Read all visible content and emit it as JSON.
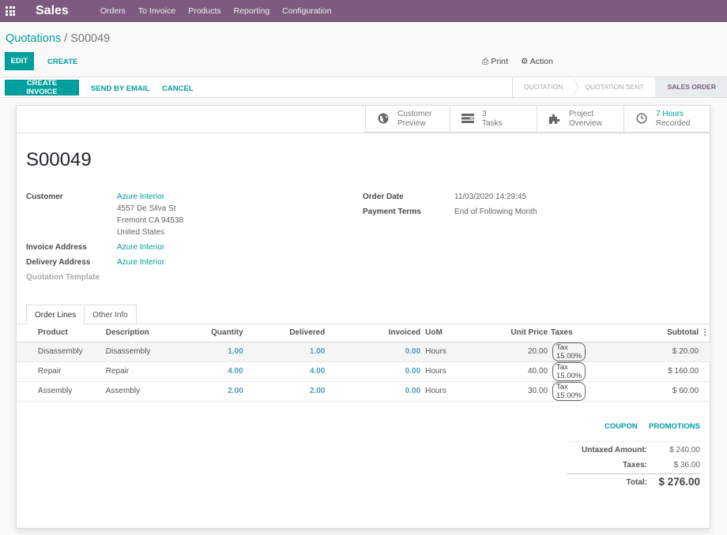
{
  "navbar": {
    "app_name": "Sales",
    "menu": [
      "Orders",
      "To Invoice",
      "Products",
      "Reporting",
      "Configuration"
    ],
    "bg_color": "#7c5b7e"
  },
  "breadcrumb": {
    "parent": "Quotations",
    "separator": " / ",
    "current": "S00049"
  },
  "control": {
    "edit": "EDIT",
    "create": "CREATE",
    "print": "Print",
    "action": "Action"
  },
  "statusbar": {
    "buttons": {
      "create_invoice": "CREATE INVOICE",
      "send_by_email": "SEND BY EMAIL",
      "cancel": "CANCEL"
    },
    "stages": [
      {
        "label": "QUOTATION",
        "active": false
      },
      {
        "label": "QUOTATION SENT",
        "active": false
      },
      {
        "label": "SALES ORDER",
        "active": true
      }
    ]
  },
  "smart_buttons": [
    {
      "icon": "globe-icon",
      "value": "Customer",
      "label": "Preview"
    },
    {
      "icon": "tasks-icon",
      "value": "3",
      "label": "Tasks"
    },
    {
      "icon": "puzzle-icon",
      "value": "Project",
      "label": "Overview"
    },
    {
      "icon": "clock-icon",
      "value": "7 Hours",
      "label": "Recorded"
    }
  ],
  "order": {
    "name": "S00049",
    "customer_label": "Customer",
    "customer_name": "Azure Interior",
    "customer_address": [
      "4557 De Silva St",
      "Fremont CA 94538",
      "United States"
    ],
    "invoice_address_label": "Invoice Address",
    "invoice_address": "Azure Interior",
    "delivery_address_label": "Delivery Address",
    "delivery_address": "Azure Interior",
    "quotation_template_label": "Quotation Template",
    "order_date_label": "Order Date",
    "order_date": "11/03/2020 14:29:45",
    "payment_terms_label": "Payment Terms",
    "payment_terms": "End of Following Month"
  },
  "tabs": [
    "Order Lines",
    "Other Info"
  ],
  "lines": {
    "columns": [
      "Product",
      "Description",
      "Quantity",
      "Delivered",
      "Invoiced",
      "UoM",
      "Unit Price",
      "Taxes",
      "Subtotal"
    ],
    "rows": [
      {
        "product": "Disassembly",
        "description": "Disassembly",
        "quantity": "1.00",
        "delivered": "1.00",
        "invoiced": "0.00",
        "uom": "Hours",
        "unit_price": "20.00",
        "taxes": "Tax 15.00%",
        "subtotal": "$ 20.00"
      },
      {
        "product": "Repair",
        "description": "Repair",
        "quantity": "4.00",
        "delivered": "4.00",
        "invoiced": "0.00",
        "uom": "Hours",
        "unit_price": "40.00",
        "taxes": "Tax 15.00%",
        "subtotal": "$ 160.00"
      },
      {
        "product": "Assembly",
        "description": "Assembly",
        "quantity": "2.00",
        "delivered": "2.00",
        "invoiced": "0.00",
        "uom": "Hours",
        "unit_price": "30.00",
        "taxes": "Tax 15.00%",
        "subtotal": "$ 60.00"
      }
    ]
  },
  "totals": {
    "coupon": "COUPON",
    "promotions": "PROMOTIONS",
    "untaxed_label": "Untaxed Amount:",
    "untaxed": "$ 240.00",
    "taxes_label": "Taxes:",
    "taxes": "$ 36.00",
    "total_label": "Total:",
    "total": "$ 276.00"
  }
}
